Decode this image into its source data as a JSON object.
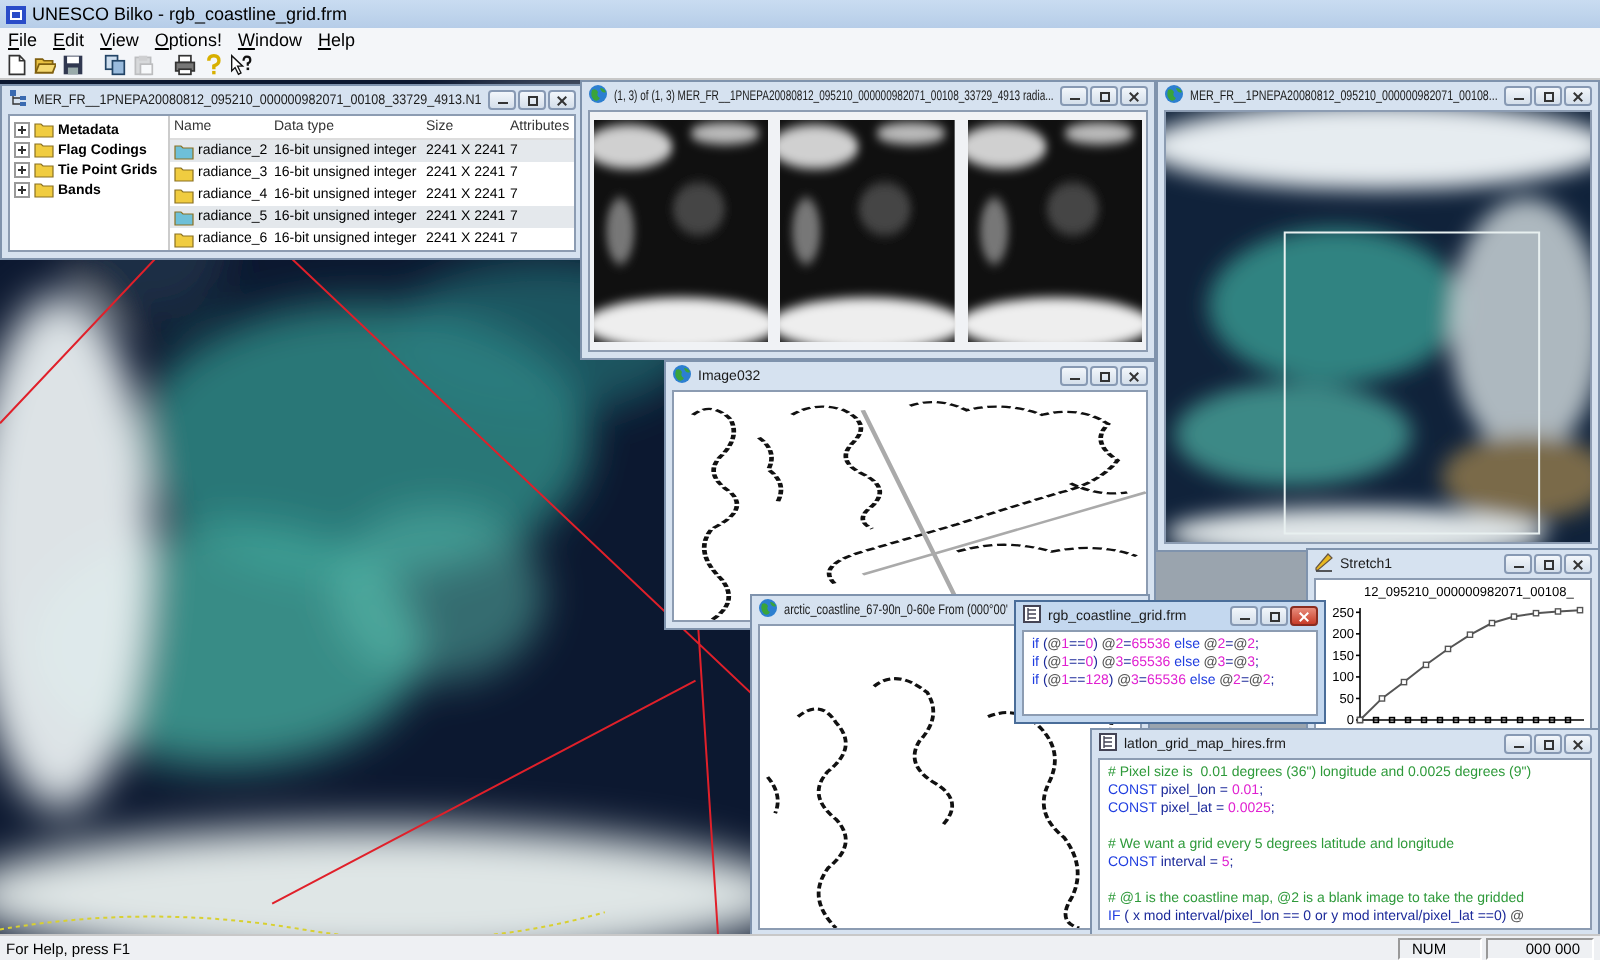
{
  "app": {
    "title": "UNESCO Bilko - rgb_coastline_grid.frm"
  },
  "menu": [
    "File",
    "Edit",
    "View",
    "Options!",
    "Window",
    "Help"
  ],
  "toolbar": [
    {
      "disabled": false
    },
    {
      "disabled": false
    },
    {
      "disabled": false
    },
    {
      "disabled": false
    },
    {
      "disabled": true
    },
    {
      "disabled": false
    },
    {
      "disabled": false
    },
    {
      "disabled": false
    }
  ],
  "windows": [
    {
      "kind": "dataset",
      "title": "MER_FR__1PNEPA20080812_095210_000000982071_00108_33729_4913.N1",
      "active": false,
      "tree": [
        {
          "label": "Metadata",
          "expanded": false
        },
        {
          "label": "Flag Codings",
          "expanded": false
        },
        {
          "label": "Tie Point Grids",
          "expanded": false
        },
        {
          "label": "Bands",
          "expanded": false
        }
      ],
      "table": {
        "columns": [
          "Name",
          "Data type",
          "Size",
          "Attributes"
        ],
        "rows": [
          {
            "cells": [
              "radiance_2",
              "16-bit unsigned integer",
              "2241 X 2241",
              "7"
            ],
            "selected": true
          },
          {
            "cells": [
              "radiance_3",
              "16-bit unsigned integer",
              "2241 X 2241",
              "7"
            ],
            "selected": false
          },
          {
            "cells": [
              "radiance_4",
              "16-bit unsigned integer",
              "2241 X 2241",
              "7"
            ],
            "selected": false
          },
          {
            "cells": [
              "radiance_5",
              "16-bit unsigned integer",
              "2241 X 2241",
              "7"
            ],
            "selected": true
          },
          {
            "cells": [
              "radiance_6",
              "16-bit unsigned integer",
              "2241 X 2241",
              "7"
            ],
            "selected": false
          }
        ]
      }
    },
    {
      "kind": "image-strip",
      "title": "(1, 3) of (1, 3) MER_FR__1PNEPA20080812_095210_000000982071_00108_33729_4913 radia...",
      "active": false
    },
    {
      "kind": "image",
      "title": "MER_FR__1PNEPA20080812_095210_000000982071_00108...",
      "active": false
    },
    {
      "kind": "map",
      "title": "Image032",
      "active": false
    },
    {
      "kind": "chart",
      "title": "Stretch1",
      "active": false,
      "chart_data": {
        "type": "line",
        "title": "12_095210_000000982071_00108_",
        "ylim": [
          0,
          260
        ],
        "yticks": [
          0,
          50,
          100,
          150,
          200,
          250
        ],
        "series": [
          {
            "color": "#555555",
            "marker": "square",
            "values": [
              0,
              50,
              88,
              128,
              165,
              198,
              225,
              240,
              248,
              252,
              255
            ]
          }
        ]
      }
    },
    {
      "kind": "map",
      "title": "arctic_coastline_67-90n_0-60e From (000°00'",
      "active": false
    },
    {
      "kind": "code",
      "title": "latlon_grid_map_hires.frm",
      "active": false,
      "lines": [
        [
          {
            "kind": "comment",
            "text": "# Pixel size is  0.01 degrees (36\") longitude and 0.0025 degrees (9\")"
          }
        ],
        [
          {
            "kind": "keyword",
            "text": "CONST"
          },
          {
            "kind": "plain",
            "text": " pixel_lon = "
          },
          {
            "kind": "number",
            "text": "0.01"
          },
          {
            "kind": "plain",
            "text": ";"
          }
        ],
        [
          {
            "kind": "keyword",
            "text": "CONST"
          },
          {
            "kind": "plain",
            "text": " pixel_lat = "
          },
          {
            "kind": "number",
            "text": "0.0025"
          },
          {
            "kind": "plain",
            "text": ";"
          }
        ],
        [
          {
            "kind": "comment",
            "text": "# We want a grid every 5 degrees latitude and longitude"
          }
        ],
        [
          {
            "kind": "keyword",
            "text": "CONST"
          },
          {
            "kind": "plain",
            "text": " interval = "
          },
          {
            "kind": "number",
            "text": "5"
          },
          {
            "kind": "plain",
            "text": ";"
          }
        ],
        [
          {
            "kind": "comment",
            "text": "# @1 is the coastline map, @2 is a blank image to take the gridded"
          }
        ],
        [
          {
            "kind": "keyword",
            "text": "IF"
          },
          {
            "kind": "plain",
            "text": " ( x mod interval/pixel_lon == 0 or y mod interval/pixel_lat ==0) "
          },
          {
            "kind": "at",
            "text": "@"
          }
        ]
      ]
    },
    {
      "kind": "code",
      "title": "rgb_coastline_grid.frm",
      "active": true,
      "lines": [
        [
          {
            "kind": "keyword",
            "text": "if"
          },
          {
            "kind": "plain",
            "text": " ("
          },
          {
            "kind": "at",
            "text": "@"
          },
          {
            "kind": "number",
            "text": "1"
          },
          {
            "kind": "plain",
            "text": "=="
          },
          {
            "kind": "number",
            "text": "0"
          },
          {
            "kind": "plain",
            "text": ") "
          },
          {
            "kind": "at",
            "text": "@"
          },
          {
            "kind": "number",
            "text": "2"
          },
          {
            "kind": "plain",
            "text": "="
          },
          {
            "kind": "number",
            "text": "65536"
          },
          {
            "kind": "keyword",
            "text": " else "
          },
          {
            "kind": "at",
            "text": "@"
          },
          {
            "kind": "number",
            "text": "2"
          },
          {
            "kind": "plain",
            "text": "="
          },
          {
            "kind": "at",
            "text": "@"
          },
          {
            "kind": "number",
            "text": "2"
          },
          {
            "kind": "plain",
            "text": ";"
          }
        ],
        [
          {
            "kind": "keyword",
            "text": "if"
          },
          {
            "kind": "plain",
            "text": " ("
          },
          {
            "kind": "at",
            "text": "@"
          },
          {
            "kind": "number",
            "text": "1"
          },
          {
            "kind": "plain",
            "text": "=="
          },
          {
            "kind": "number",
            "text": "0"
          },
          {
            "kind": "plain",
            "text": ") "
          },
          {
            "kind": "at",
            "text": "@"
          },
          {
            "kind": "number",
            "text": "3"
          },
          {
            "kind": "plain",
            "text": "="
          },
          {
            "kind": "number",
            "text": "65536"
          },
          {
            "kind": "keyword",
            "text": " else "
          },
          {
            "kind": "at",
            "text": "@"
          },
          {
            "kind": "number",
            "text": "3"
          },
          {
            "kind": "plain",
            "text": "="
          },
          {
            "kind": "at",
            "text": "@"
          },
          {
            "kind": "number",
            "text": "3"
          },
          {
            "kind": "plain",
            "text": ";"
          }
        ],
        [
          {
            "kind": "keyword",
            "text": "if"
          },
          {
            "kind": "plain",
            "text": " ("
          },
          {
            "kind": "at",
            "text": "@"
          },
          {
            "kind": "number",
            "text": "1"
          },
          {
            "kind": "plain",
            "text": "=="
          },
          {
            "kind": "number",
            "text": "128"
          },
          {
            "kind": "plain",
            "text": ") "
          },
          {
            "kind": "at",
            "text": "@"
          },
          {
            "kind": "number",
            "text": "3"
          },
          {
            "kind": "plain",
            "text": "="
          },
          {
            "kind": "number",
            "text": "65536"
          },
          {
            "kind": "keyword",
            "text": " else "
          },
          {
            "kind": "at",
            "text": "@"
          },
          {
            "kind": "number",
            "text": "2"
          },
          {
            "kind": "plain",
            "text": "="
          },
          {
            "kind": "at",
            "text": "@"
          },
          {
            "kind": "number",
            "text": "2"
          },
          {
            "kind": "plain",
            "text": ";"
          }
        ]
      ]
    }
  ],
  "status_bar": {
    "message": "For Help, press F1",
    "indicators": [
      "NUM",
      "000 000"
    ]
  }
}
